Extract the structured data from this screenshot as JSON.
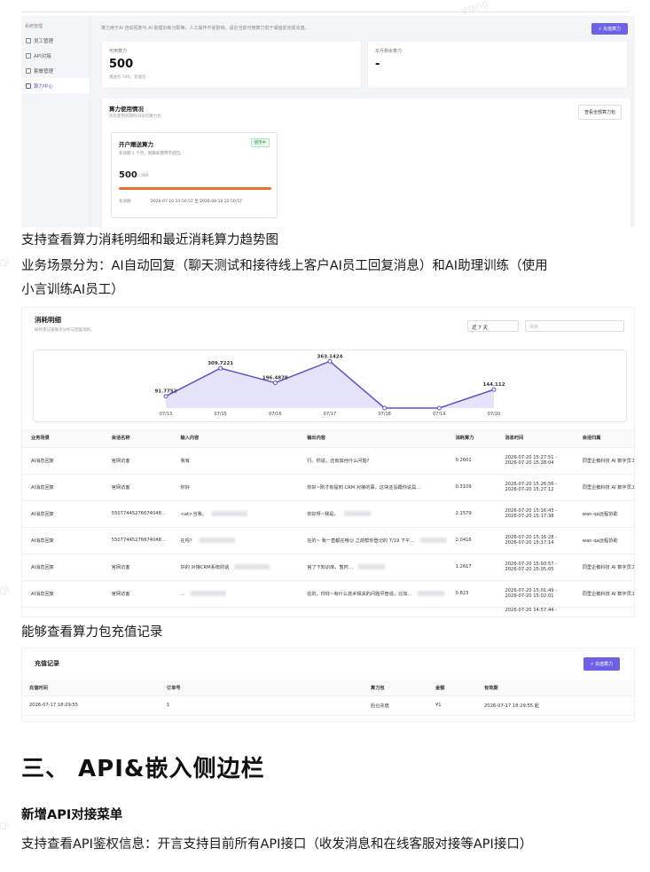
{
  "shot1": {
    "sidebar_group": "系统管理",
    "sidebar": [
      {
        "label": "员工管理",
        "icon": "people-icon"
      },
      {
        "label": "API对接",
        "icon": "link-icon"
      },
      {
        "label": "套餐管理",
        "icon": "box-icon"
      },
      {
        "label": "算力中心",
        "icon": "bolt-icon"
      }
    ],
    "hint": "算力用于AI 自动回复与 AI 助理训练分配等。人工操作不受影响。请在当前可用算力低于阈值前完成充值。",
    "recharge_button": "⚡ 充值算力",
    "available": {
      "label": "可用算力",
      "value": "500",
      "sub": "赠送包 500，充值包 -"
    },
    "monthly": {
      "label": "本月剩余算力",
      "value": "-"
    },
    "usage": {
      "title": "算力使用情况",
      "subtitle": "优先使用到期时间早的算力包",
      "button": "查看全部算力包",
      "package": {
        "name": "开户赠送算力",
        "badge": "使用中",
        "desc": "有效期 1 个月，到期未使用不退回。",
        "amount": "500",
        "total": "/ 500",
        "validity_label": "有效期",
        "validity": "2026-07-10 23:50:57 至 2026-08-10 22:50:57"
      }
    }
  },
  "text": {
    "p1": "支持查看算力消耗明细和最近消耗算力趋势图",
    "p2a": "业务场景分为：AI自动回复（聊天测试和接待线上客户AI员工回复消息）和AI助理训练（使用",
    "p2b": "小言训练AI员工）",
    "p3": "能够查看算力包充值记录",
    "section": "三、 API&嵌入侧边栏",
    "sub": "新增API对接菜单",
    "p4": "支持查看API鉴权信息：开言支持目前所有API接口（收发消息和在线客服对接等API接口）"
  },
  "shot2": {
    "title": "消耗明细",
    "subtitle": "按场景记录每次分析与回复消耗。",
    "range": "近 7 天",
    "filter_placeholder": "场景",
    "table": {
      "headers": [
        "业务场景",
        "会话名称",
        "输入内容",
        "输出内容",
        "消耗算力",
        "消息时间",
        "会话归属"
      ],
      "rows": [
        [
          "AI消息回复",
          "官网访客",
          "我有",
          "行。你说，还有其他什么问题?",
          "0.2601",
          "2026-07-20 15:27:51 -",
          "2026-07-20 15:28:04",
          "同里企鹅科技 AI 数字员工"
        ],
        [
          "AI消息回复",
          "官网访客",
          "你好",
          "你好~刚才有提到 CRM 对接的事，这块还没跟你说具…",
          "0.3109",
          "2026-07-20 15:26:56 -",
          "2026-07-20 15:27:12",
          "同里企鹅科技 AI 数字员工"
        ],
        [
          "AI消息回复",
          "55077445276674048…",
          "<at>当我，",
          "你好呀~我是，",
          "2.1579",
          "2026-07-20 15:16:43 -",
          "2026-07-20 15:17:38",
          "wan-qa远程协助"
        ],
        [
          "AI消息回复",
          "55077445276674048…",
          "在吗？",
          "在的~ 我一直都在哦😊 之前帮你登记的 7/19 下午…",
          "2.0416",
          "2026-07-20 15:16:28 -",
          "2026-07-20 15:17:14",
          "wan-qa远程协助"
        ],
        [
          "AI消息回复",
          "官网访客",
          "好的 对接CRM系统的话",
          "官了下知识库，暂时…",
          "1.2617",
          "2026-07-20 15:03:57 -",
          "2026-07-20 15:05:05",
          "同里企鹅科技 AI 数字员工"
        ],
        [
          "AI消息回复",
          "官网访客",
          "…",
          "在的。你好~有什么技术相关的问题尽管说，比如…",
          "0.823",
          "2026-07-20 15:01:49 -",
          "2026-07-20 15:02:01",
          "同里企鹅科技 AI 数字员工"
        ]
      ],
      "trailing_time": "2026-07-20 14:57:44 -"
    }
  },
  "chart_data": {
    "type": "area",
    "categories": [
      "07/13",
      "07/15",
      "07/16",
      "07/17",
      "07/18",
      "07/19",
      "07/20"
    ],
    "series": [
      {
        "values": [
          91.7752,
          309.7221,
          196.4878,
          363.1424,
          0,
          0,
          144.112
        ]
      }
    ],
    "point_labels": [
      "91.7752",
      "309.7221",
      "196.4878",
      "363.1424",
      "",
      "",
      "144.112"
    ],
    "ylim": [
      0,
      400
    ],
    "color": "#5b56c9",
    "fill": "#e4e3fa"
  },
  "shot3": {
    "title": "充值记录",
    "button": "⚡ 充值算力",
    "headers": [
      "充值时间",
      "订单号",
      "算力包",
      "金额",
      "有效期"
    ],
    "rows": [
      [
        "2026-07-17 18:29:55",
        "1",
        "后台充值",
        "¥1",
        "2026-07-17 18:29:55 起"
      ]
    ]
  }
}
